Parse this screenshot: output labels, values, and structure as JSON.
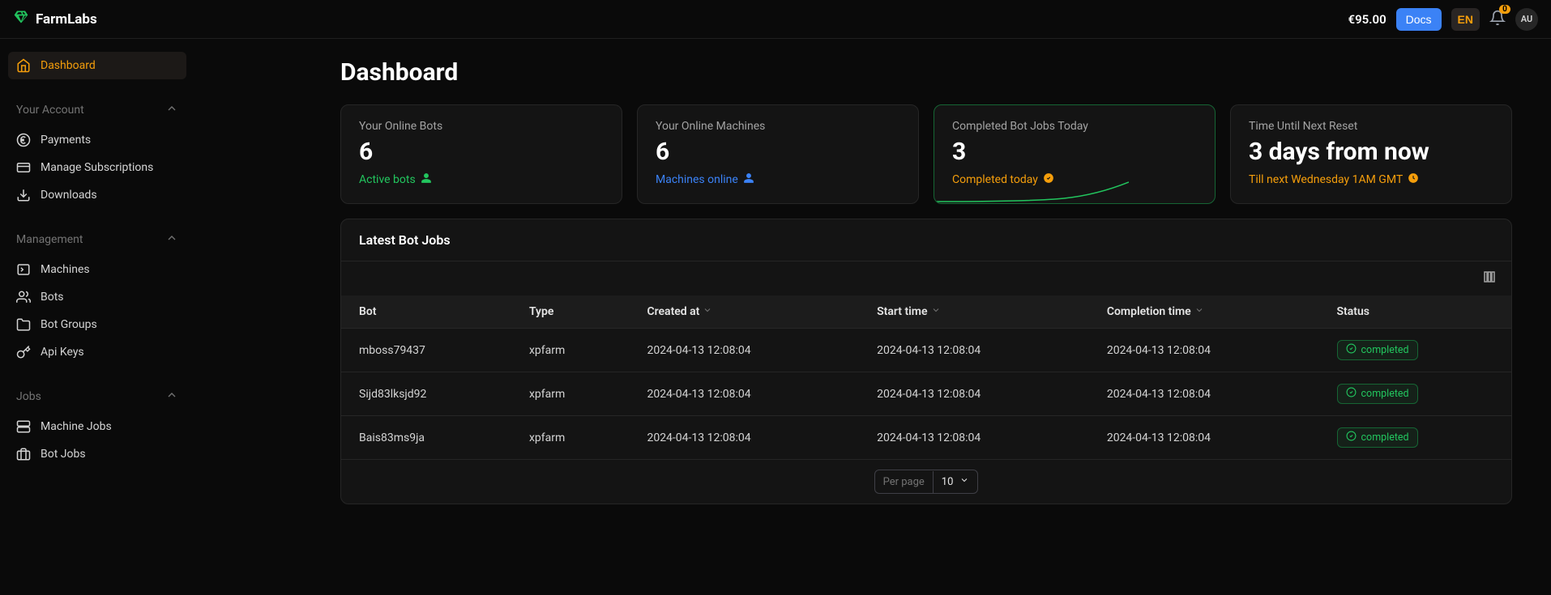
{
  "header": {
    "brand": "FarmLabs",
    "balance": "€95.00",
    "docs": "Docs",
    "lang": "EN",
    "notif_count": "0",
    "avatar": "AU"
  },
  "sidebar": {
    "dashboard": "Dashboard",
    "sections": {
      "account": {
        "label": "Your Account",
        "items": [
          "Payments",
          "Manage Subscriptions",
          "Downloads"
        ]
      },
      "management": {
        "label": "Management",
        "items": [
          "Machines",
          "Bots",
          "Bot Groups",
          "Api Keys"
        ]
      },
      "jobs": {
        "label": "Jobs",
        "items": [
          "Machine Jobs",
          "Bot Jobs"
        ]
      }
    }
  },
  "page": {
    "title": "Dashboard"
  },
  "stats": [
    {
      "label": "Your Online Bots",
      "value": "6",
      "sub": "Active bots",
      "color": "green",
      "icon": "user"
    },
    {
      "label": "Your Online Machines",
      "value": "6",
      "sub": "Machines online",
      "color": "blue",
      "icon": "user"
    },
    {
      "label": "Completed Bot Jobs Today",
      "value": "3",
      "sub": "Completed today",
      "color": "yellow",
      "icon": "check",
      "highlight": true
    },
    {
      "label": "Time Until Next Reset",
      "value": "3 days from now",
      "sub": "Till next Wednesday 1AM GMT",
      "color": "yellow",
      "icon": "clock"
    }
  ],
  "table": {
    "title": "Latest Bot Jobs",
    "columns": [
      "Bot",
      "Type",
      "Created at",
      "Start time",
      "Completion time",
      "Status"
    ],
    "rows": [
      {
        "bot": "mboss79437",
        "type": "xpfarm",
        "created": "2024-04-13 12:08:04",
        "start": "2024-04-13 12:08:04",
        "end": "2024-04-13 12:08:04",
        "status": "completed"
      },
      {
        "bot": "Sijd83lksjd92",
        "type": "xpfarm",
        "created": "2024-04-13 12:08:04",
        "start": "2024-04-13 12:08:04",
        "end": "2024-04-13 12:08:04",
        "status": "completed"
      },
      {
        "bot": "Bais83ms9ja",
        "type": "xpfarm",
        "created": "2024-04-13 12:08:04",
        "start": "2024-04-13 12:08:04",
        "end": "2024-04-13 12:08:04",
        "status": "completed"
      }
    ],
    "pager": {
      "label": "Per page",
      "value": "10"
    }
  }
}
